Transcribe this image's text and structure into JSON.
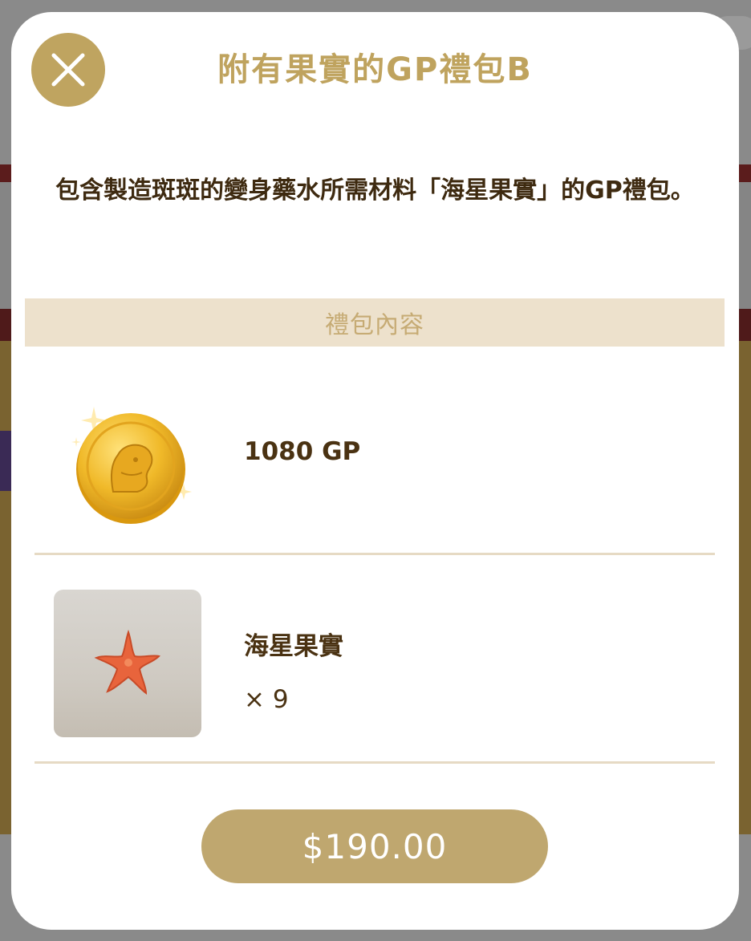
{
  "modal": {
    "title": "附有果實的GP禮包B",
    "description": "包含製造斑斑的變身藥水所需材料「海星果實」的GP禮包。",
    "section_header": "禮包內容",
    "items": [
      {
        "name": "1080 GP",
        "icon": "gold-coin-icon"
      },
      {
        "name": "海星果實",
        "quantity": "× 9",
        "icon": "starfish-icon"
      }
    ],
    "price_label": "$190.00"
  },
  "colors": {
    "accent_gold": "#bfa35e",
    "section_bg": "#ede1cc",
    "text_dark": "#3e2a10",
    "button_bg": "#bfa76f"
  }
}
